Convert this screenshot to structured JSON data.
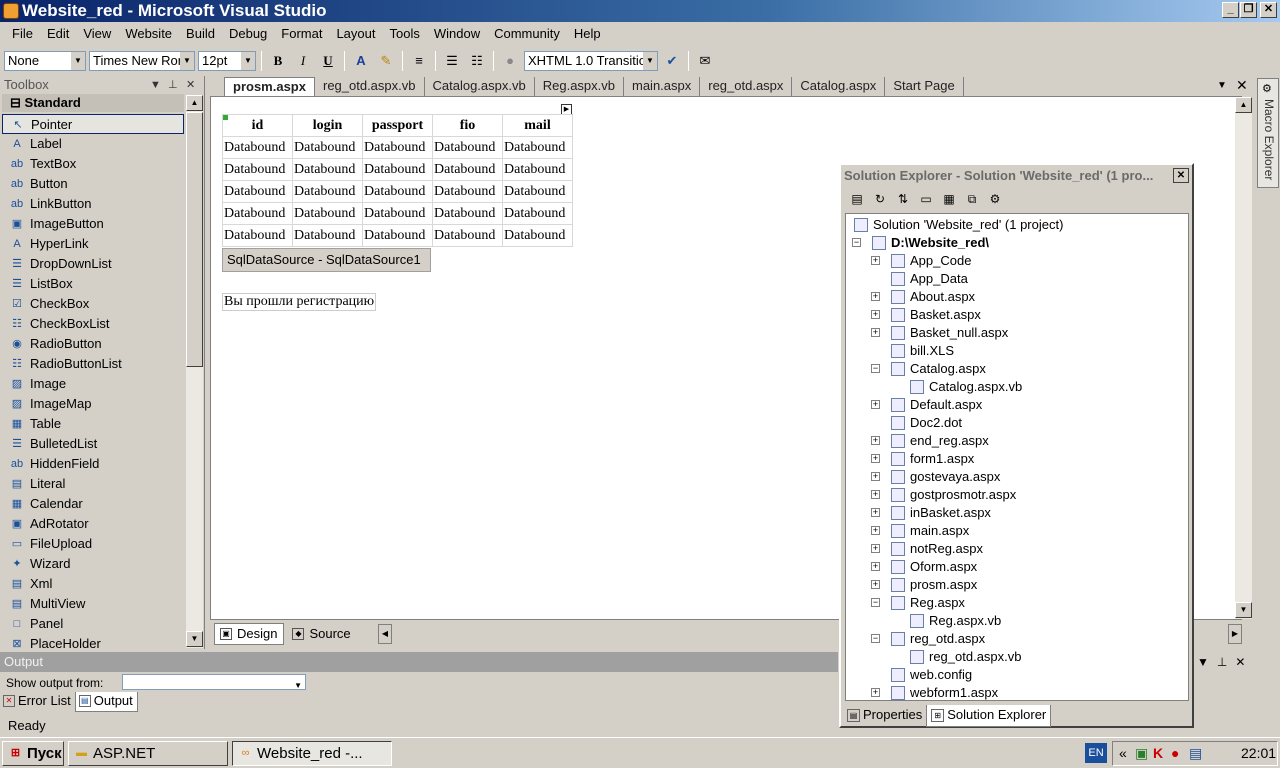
{
  "window": {
    "title": "Website_red - Microsoft Visual Studio"
  },
  "menu": [
    "File",
    "Edit",
    "View",
    "Website",
    "Build",
    "Debug",
    "Format",
    "Layout",
    "Tools",
    "Window",
    "Community",
    "Help"
  ],
  "format_toolbar": {
    "block_format": "None",
    "font_name": "Times New Ror",
    "font_size": "12pt",
    "doctype": "XHTML 1.0 Transitio"
  },
  "toolbox": {
    "title": "Toolbox",
    "category": "Standard",
    "items": [
      {
        "label": "Pointer",
        "icon": "pointer-icon",
        "glyph": "↖"
      },
      {
        "label": "Label",
        "icon": "label-icon",
        "glyph": "A"
      },
      {
        "label": "TextBox",
        "icon": "textbox-icon",
        "glyph": "ab"
      },
      {
        "label": "Button",
        "icon": "button-icon",
        "glyph": "ab"
      },
      {
        "label": "LinkButton",
        "icon": "linkbutton-icon",
        "glyph": "ab"
      },
      {
        "label": "ImageButton",
        "icon": "imagebutton-icon",
        "glyph": "▣"
      },
      {
        "label": "HyperLink",
        "icon": "hyperlink-icon",
        "glyph": "A"
      },
      {
        "label": "DropDownList",
        "icon": "dropdownlist-icon",
        "glyph": "☰"
      },
      {
        "label": "ListBox",
        "icon": "listbox-icon",
        "glyph": "☰"
      },
      {
        "label": "CheckBox",
        "icon": "checkbox-icon",
        "glyph": "☑"
      },
      {
        "label": "CheckBoxList",
        "icon": "checkboxlist-icon",
        "glyph": "☷"
      },
      {
        "label": "RadioButton",
        "icon": "radiobutton-icon",
        "glyph": "◉"
      },
      {
        "label": "RadioButtonList",
        "icon": "radiobuttonlist-icon",
        "glyph": "☷"
      },
      {
        "label": "Image",
        "icon": "image-icon",
        "glyph": "▨"
      },
      {
        "label": "ImageMap",
        "icon": "imagemap-icon",
        "glyph": "▨"
      },
      {
        "label": "Table",
        "icon": "table-icon",
        "glyph": "▦"
      },
      {
        "label": "BulletedList",
        "icon": "bulletedlist-icon",
        "glyph": "☰"
      },
      {
        "label": "HiddenField",
        "icon": "hiddenfield-icon",
        "glyph": "ab"
      },
      {
        "label": "Literal",
        "icon": "literal-icon",
        "glyph": "▤"
      },
      {
        "label": "Calendar",
        "icon": "calendar-icon",
        "glyph": "▦"
      },
      {
        "label": "AdRotator",
        "icon": "adrotator-icon",
        "glyph": "▣"
      },
      {
        "label": "FileUpload",
        "icon": "fileupload-icon",
        "glyph": "▭"
      },
      {
        "label": "Wizard",
        "icon": "wizard-icon",
        "glyph": "✦"
      },
      {
        "label": "Xml",
        "icon": "xml-icon",
        "glyph": "▤"
      },
      {
        "label": "MultiView",
        "icon": "multiview-icon",
        "glyph": "▤"
      },
      {
        "label": "Panel",
        "icon": "panel-icon",
        "glyph": "□"
      },
      {
        "label": "PlaceHolder",
        "icon": "placeholder-icon",
        "glyph": "⊠"
      }
    ]
  },
  "doc_tabs": [
    "prosm.aspx",
    "reg_otd.aspx.vb",
    "Catalog.aspx.vb",
    "Reg.aspx.vb",
    "main.aspx",
    "reg_otd.aspx",
    "Catalog.aspx",
    "Start Page"
  ],
  "grid": {
    "columns": [
      "id",
      "login",
      "passport",
      "fio",
      "mail"
    ],
    "rows": [
      [
        "Databound",
        "Databound",
        "Databound",
        "Databound",
        "Databound"
      ],
      [
        "Databound",
        "Databound",
        "Databound",
        "Databound",
        "Databound"
      ],
      [
        "Databound",
        "Databound",
        "Databound",
        "Databound",
        "Databound"
      ],
      [
        "Databound",
        "Databound",
        "Databound",
        "Databound",
        "Databound"
      ],
      [
        "Databound",
        "Databound",
        "Databound",
        "Databound",
        "Databound"
      ]
    ]
  },
  "sqldatasource": {
    "type": "SqlDataSource",
    "name": " - SqlDataSource1"
  },
  "registration_label": "Вы прошли регистрацию",
  "view_tabs": {
    "design": "Design",
    "source": "Source"
  },
  "solution_explorer": {
    "title": "Solution Explorer - Solution 'Website_red' (1 pro...",
    "solution": "Solution 'Website_red' (1 project)",
    "project": "D:\\Website_red\\",
    "nodes": [
      {
        "label": "App_Code",
        "level": 1,
        "exp": "+",
        "icon": "folder-icon"
      },
      {
        "label": "App_Data",
        "level": 1,
        "exp": "",
        "icon": "folder-icon"
      },
      {
        "label": "About.aspx",
        "level": 1,
        "exp": "+",
        "icon": "aspx-file-icon"
      },
      {
        "label": "Basket.aspx",
        "level": 1,
        "exp": "+",
        "icon": "aspx-file-icon"
      },
      {
        "label": "Basket_null.aspx",
        "level": 1,
        "exp": "+",
        "icon": "aspx-file-icon"
      },
      {
        "label": "bill.XLS",
        "level": 1,
        "exp": "",
        "icon": "excel-file-icon"
      },
      {
        "label": "Catalog.aspx",
        "level": 1,
        "exp": "−",
        "icon": "aspx-file-icon"
      },
      {
        "label": "Catalog.aspx.vb",
        "level": 2,
        "exp": "",
        "icon": "vb-file-icon"
      },
      {
        "label": "Default.aspx",
        "level": 1,
        "exp": "+",
        "icon": "aspx-file-icon"
      },
      {
        "label": "Doc2.dot",
        "level": 1,
        "exp": "",
        "icon": "word-file-icon"
      },
      {
        "label": "end_reg.aspx",
        "level": 1,
        "exp": "+",
        "icon": "aspx-file-icon"
      },
      {
        "label": "form1.aspx",
        "level": 1,
        "exp": "+",
        "icon": "aspx-file-icon"
      },
      {
        "label": "gostevaya.aspx",
        "level": 1,
        "exp": "+",
        "icon": "aspx-file-icon"
      },
      {
        "label": "gostprosmotr.aspx",
        "level": 1,
        "exp": "+",
        "icon": "aspx-file-icon"
      },
      {
        "label": "inBasket.aspx",
        "level": 1,
        "exp": "+",
        "icon": "aspx-file-icon"
      },
      {
        "label": "main.aspx",
        "level": 1,
        "exp": "+",
        "icon": "aspx-file-icon"
      },
      {
        "label": "notReg.aspx",
        "level": 1,
        "exp": "+",
        "icon": "aspx-file-icon"
      },
      {
        "label": "Oform.aspx",
        "level": 1,
        "exp": "+",
        "icon": "aspx-file-icon"
      },
      {
        "label": "prosm.aspx",
        "level": 1,
        "exp": "+",
        "icon": "aspx-file-icon"
      },
      {
        "label": "Reg.aspx",
        "level": 1,
        "exp": "−",
        "icon": "aspx-file-icon"
      },
      {
        "label": "Reg.aspx.vb",
        "level": 2,
        "exp": "",
        "icon": "vb-file-icon"
      },
      {
        "label": "reg_otd.aspx",
        "level": 1,
        "exp": "−",
        "icon": "aspx-file-icon"
      },
      {
        "label": "reg_otd.aspx.vb",
        "level": 2,
        "exp": "",
        "icon": "vb-file-icon"
      },
      {
        "label": "web.config",
        "level": 1,
        "exp": "",
        "icon": "config-file-icon"
      },
      {
        "label": "webform1.aspx",
        "level": 1,
        "exp": "+",
        "icon": "aspx-file-icon"
      }
    ],
    "tabs": [
      "Properties",
      "Solution Explorer"
    ]
  },
  "macro_explorer": "Macro Explorer",
  "output": {
    "title": "Output",
    "show_from_label": "Show output from:",
    "tabs": [
      "Error List",
      "Output"
    ]
  },
  "status": "Ready",
  "taskbar": {
    "start": "Пуск",
    "buttons": [
      "ASP.NET",
      "Website_red -..."
    ],
    "lang": "EN",
    "clock": "22:01"
  }
}
